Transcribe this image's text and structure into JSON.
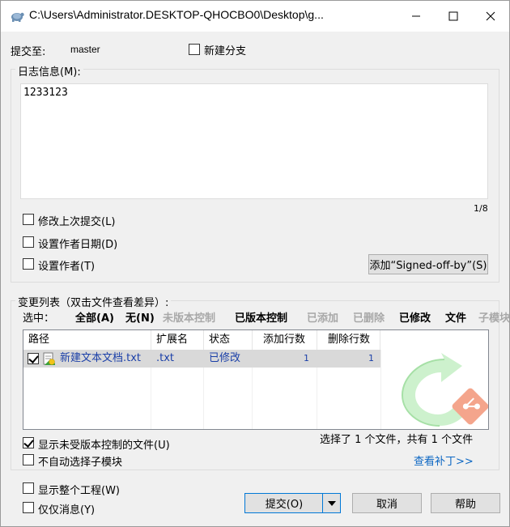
{
  "window": {
    "title": "C:\\Users\\Administrator.DESKTOP-QHOCBO0\\Desktop\\g..."
  },
  "commit_to": {
    "label": "提交至:",
    "branch": "master",
    "new_branch_label": "新建分支",
    "new_branch_checked": false
  },
  "message": {
    "label": "日志信息(M):",
    "text": "1233123",
    "counter": "1/8"
  },
  "options": {
    "amend_label": "修改上次提交(L)",
    "set_author_date_label": "设置作者日期(D)",
    "set_author_label": "设置作者(T)",
    "signed_off_button": "添加“Signed-off-by”(S)"
  },
  "changes": {
    "label": "变更列表（双击文件查看差异）:",
    "select_label": "选中：",
    "filters": [
      {
        "label": "全部(A)",
        "state": "active"
      },
      {
        "label": "无(N)",
        "state": "active"
      },
      {
        "label": "未版本控制",
        "state": "disabled"
      },
      {
        "label": "已版本控制",
        "state": "active"
      },
      {
        "label": "已添加",
        "state": "disabled"
      },
      {
        "label": "已删除",
        "state": "disabled"
      },
      {
        "label": "已修改",
        "state": "active"
      },
      {
        "label": "文件",
        "state": "active"
      },
      {
        "label": "子模块",
        "state": "disabled"
      }
    ],
    "columns": [
      "路径",
      "扩展名",
      "状态",
      "添加行数",
      "删除行数"
    ],
    "rows": [
      {
        "checked": true,
        "path": "新建文本文档.txt",
        "ext": ".txt",
        "status": "已修改",
        "added": "1",
        "deleted": "1"
      }
    ],
    "summary": "选择了 1 个文件，共有 1 个文件",
    "show_untracked_label": "显示未受版本控制的文件(U)",
    "show_untracked_checked": true,
    "no_auto_submodule_label": "不自动选择子模块",
    "no_auto_submodule_checked": false,
    "view_patch_link": "查看补丁>>"
  },
  "bottom": {
    "show_whole_project_label": "显示整个工程(W)",
    "message_only_label": "仅仅消息(Y)",
    "commit_button": "提交(O)",
    "cancel_button": "取消",
    "help_button": "帮助"
  }
}
